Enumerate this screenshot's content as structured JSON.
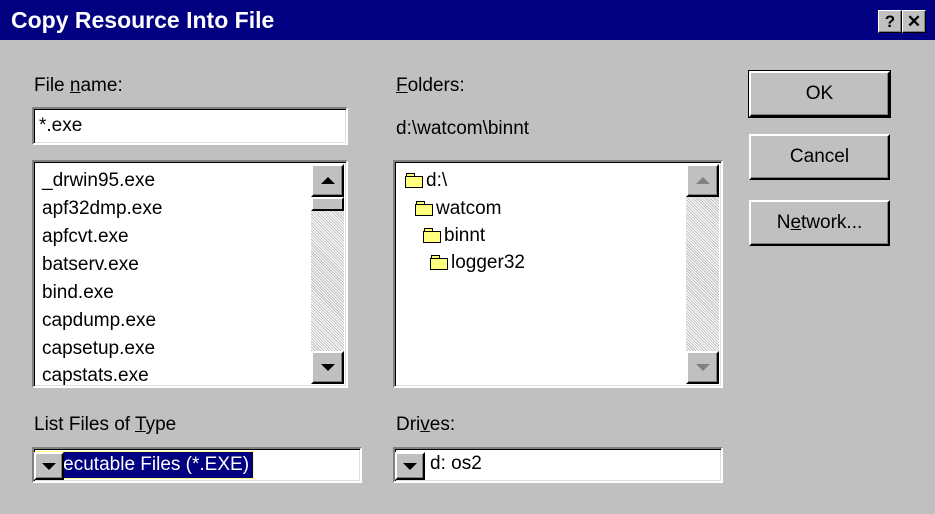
{
  "window": {
    "title": "Copy Resource Into File",
    "help_button": "?",
    "close_button": "✕"
  },
  "file_name": {
    "label_prefix": "File ",
    "label_mnemonic": "n",
    "label_suffix": "ame:",
    "value": "*.exe",
    "files": [
      "_drwin95.exe",
      "apf32dmp.exe",
      "apfcvt.exe",
      "batserv.exe",
      "bind.exe",
      "capdump.exe",
      "capsetup.exe",
      "capstats.exe"
    ]
  },
  "folders": {
    "label_mnemonic": "F",
    "label_suffix": "olders:",
    "current_path": "d:\\watcom\\binnt",
    "tree": [
      {
        "name": "d:\\",
        "icon": "open-folder-icon"
      },
      {
        "name": "watcom",
        "icon": "open-folder-icon"
      },
      {
        "name": "binnt",
        "icon": "open-folder-icon"
      },
      {
        "name": "logger32",
        "icon": "folder-icon"
      }
    ]
  },
  "file_type": {
    "label_prefix": "List Files of ",
    "label_mnemonic": "T",
    "label_suffix": "ype",
    "selected": "Executable Files (*.EXE)"
  },
  "drives": {
    "label_prefix": "Dri",
    "label_mnemonic": "v",
    "label_suffix": "es:",
    "selected": "d: os2"
  },
  "buttons": {
    "ok": "OK",
    "cancel": "Cancel",
    "network_prefix": "N",
    "network_mnemonic": "e",
    "network_suffix": "twork..."
  },
  "colors": {
    "title_bar": "#000080",
    "dialog_face": "#c0c0c0",
    "selection": "#000080"
  }
}
